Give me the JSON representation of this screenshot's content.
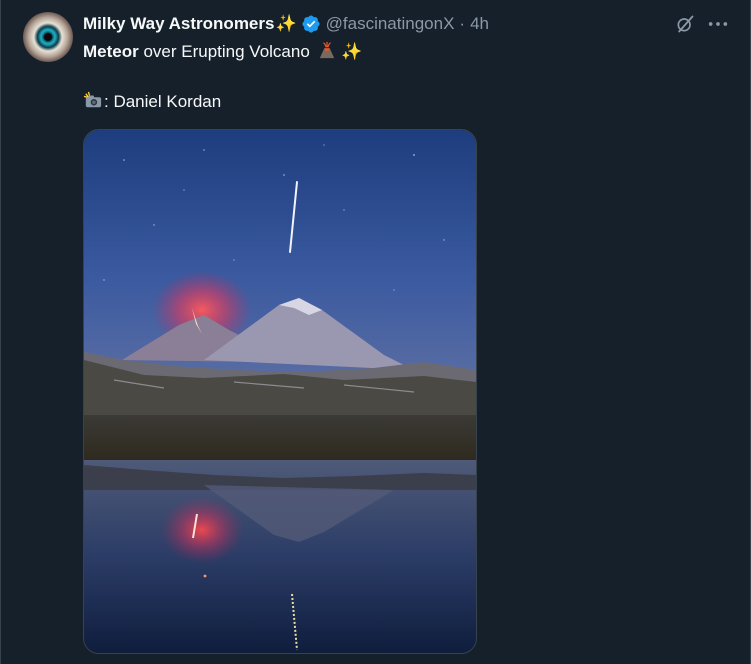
{
  "tweet": {
    "display_name": "Milky Way Astronomers",
    "name_emoji": "✨",
    "handle": "@fascinatingonX",
    "separator": "·",
    "time": "4h",
    "line1_bold": "Meteor",
    "line1_rest": " over Erupting Volcano",
    "line1_trailing_emoji": "✨",
    "line2_text": ": Daniel Kordan"
  },
  "icons": {
    "verified": "verified-badge-icon",
    "grok": "grok-icon",
    "more": "more-options-icon",
    "volcano": "volcano-emoji-icon",
    "camera": "camera-flash-emoji-icon"
  },
  "colors": {
    "background": "#15202b",
    "text": "#f7f9f9",
    "secondary": "#8b98a5",
    "verified": "#1d9bf0",
    "border": "#38444d"
  }
}
